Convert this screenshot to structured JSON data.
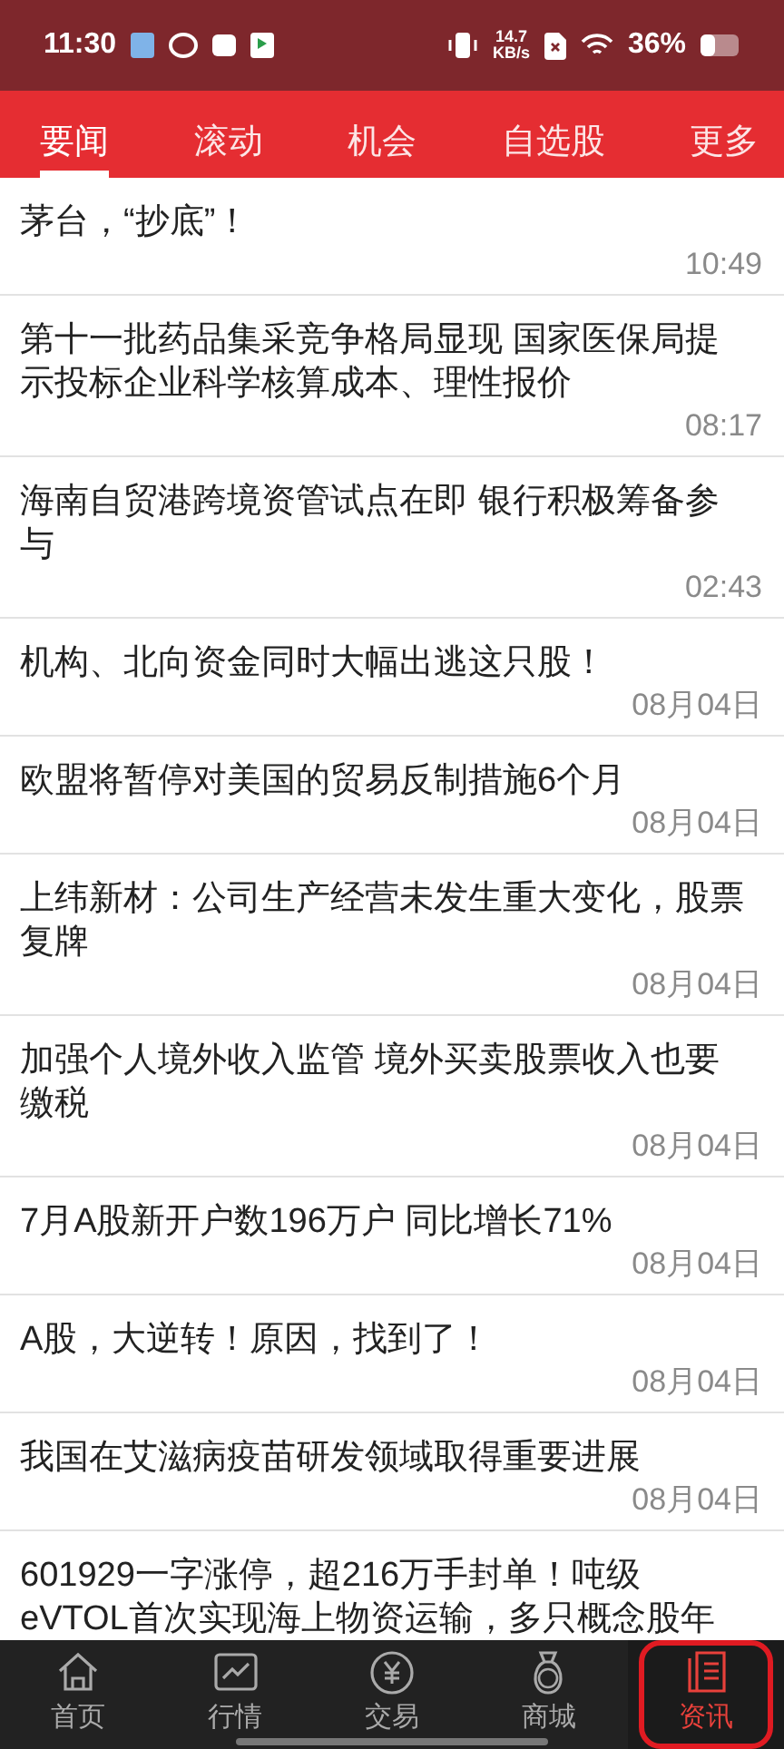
{
  "status_bar": {
    "time": "11:30",
    "net_speed": "14.7",
    "net_unit": "KB/s",
    "battery": "36%"
  },
  "tabs": [
    {
      "label": "要闻",
      "selected": true
    },
    {
      "label": "滚动",
      "selected": false
    },
    {
      "label": "机会",
      "selected": false
    },
    {
      "label": "自选股",
      "selected": false
    },
    {
      "label": "更多",
      "selected": false
    }
  ],
  "news": [
    {
      "title": "茅台，“抄底”！",
      "time": "10:49"
    },
    {
      "title": "第十一批药品集采竞争格局显现 国家医保局提示投标企业科学核算成本、理性报价",
      "time": "08:17"
    },
    {
      "title": "海南自贸港跨境资管试点在即 银行积极筹备参与",
      "time": "02:43"
    },
    {
      "title": "机构、北向资金同时大幅出逃这只股！",
      "time": "08月04日"
    },
    {
      "title": "欧盟将暂停对美国的贸易反制措施6个月",
      "time": "08月04日"
    },
    {
      "title": "上纬新材：公司生产经营未发生重大变化，股票复牌",
      "time": "08月04日"
    },
    {
      "title": "加强个人境外收入监管 境外买卖股票收入也要缴税",
      "time": "08月04日"
    },
    {
      "title": "7月A股新开户数196万户 同比增长71%",
      "time": "08月04日"
    },
    {
      "title": "A股，大逆转！原因，找到了！",
      "time": "08月04日"
    },
    {
      "title": "我国在艾滋病疫苗研发领域取得重要进展",
      "time": "08月04日"
    },
    {
      "title": "601929一字涨停，超216万手封单！吨级eVTOL首次实现海上物资运输，多只概念股年"
    }
  ],
  "bottom_nav": [
    {
      "label": "首页",
      "selected": false,
      "highlighted": false
    },
    {
      "label": "行情",
      "selected": false,
      "highlighted": false
    },
    {
      "label": "交易",
      "selected": false,
      "highlighted": false
    },
    {
      "label": "商城",
      "selected": false,
      "highlighted": false
    },
    {
      "label": "资讯",
      "selected": true,
      "highlighted": true
    }
  ]
}
